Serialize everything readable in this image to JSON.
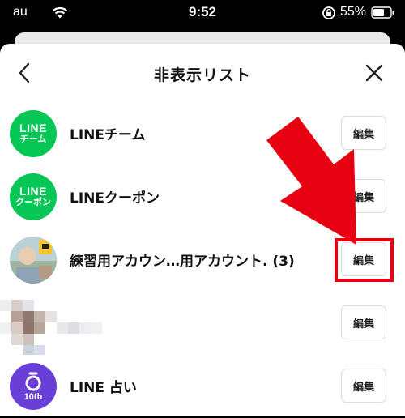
{
  "status_bar": {
    "carrier": "au",
    "time": "9:52",
    "battery_percent": "55%"
  },
  "header": {
    "title": "非表示リスト",
    "back_icon": "chevron-left-icon",
    "close_icon": "close-icon"
  },
  "rows": [
    {
      "name": "LINEチーム",
      "avatar_line1": "LINE",
      "avatar_line2": "チーム",
      "avatar_color": "#06c755",
      "edit_label": "編集"
    },
    {
      "name": "LINEクーポン",
      "avatar_line1": "LINE",
      "avatar_line2": "クーポン",
      "avatar_color": "#06c755",
      "edit_label": "編集"
    },
    {
      "name": "練習用アカウン…用アカウント. (3)",
      "edit_label": "編集"
    },
    {
      "name": "",
      "edit_label": "編集"
    },
    {
      "name": "LINE 占い",
      "avatar_line2": "10th",
      "avatar_color": "#6a3fd8",
      "edit_label": "編集"
    }
  ],
  "annotation": {
    "color": "#e60012"
  }
}
